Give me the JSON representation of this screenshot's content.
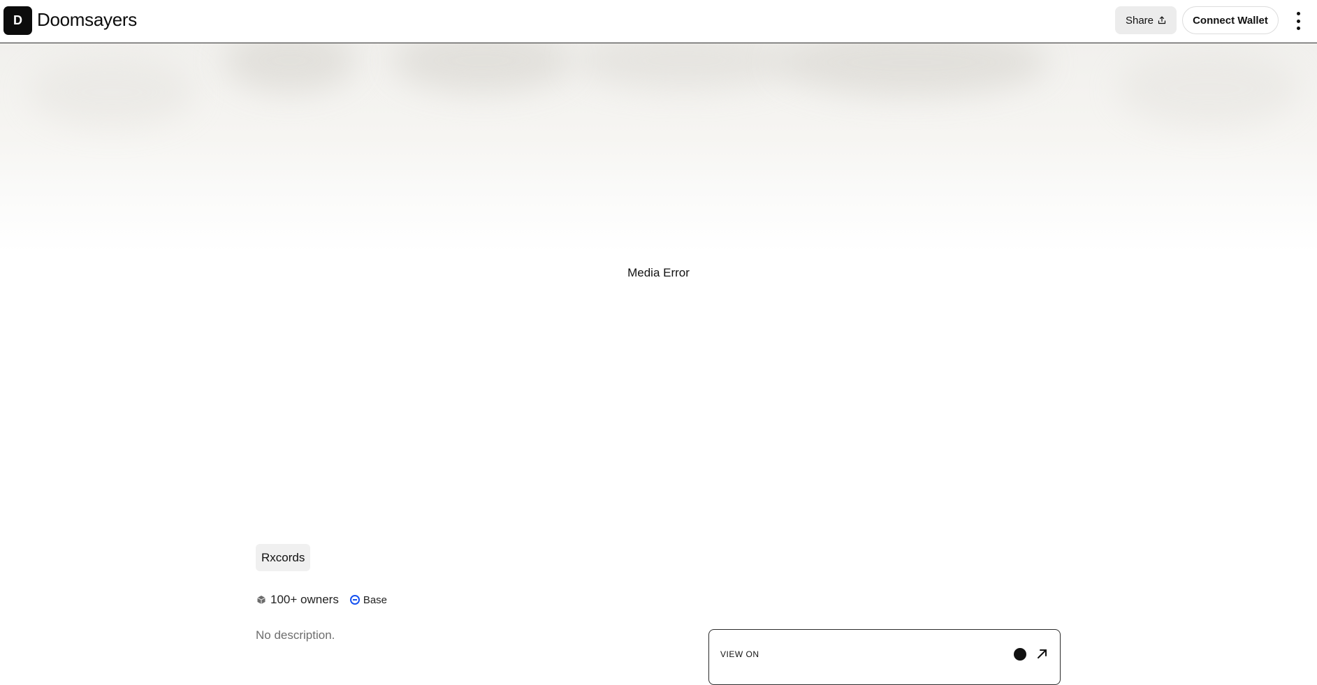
{
  "header": {
    "logo_letter": "D",
    "brand_name": "Doomsayers",
    "share_label": "Share",
    "connect_label": "Connect Wallet"
  },
  "hero": {
    "media_error": "Media Error"
  },
  "collection": {
    "tag": "Rxcords",
    "owners": "100+ owners",
    "chain": "Base",
    "description": "No description."
  },
  "view_on": {
    "label": "VIEW ON"
  },
  "colors": {
    "base_blue": "#1652f0",
    "brand_dark": "#0c0c0c"
  }
}
